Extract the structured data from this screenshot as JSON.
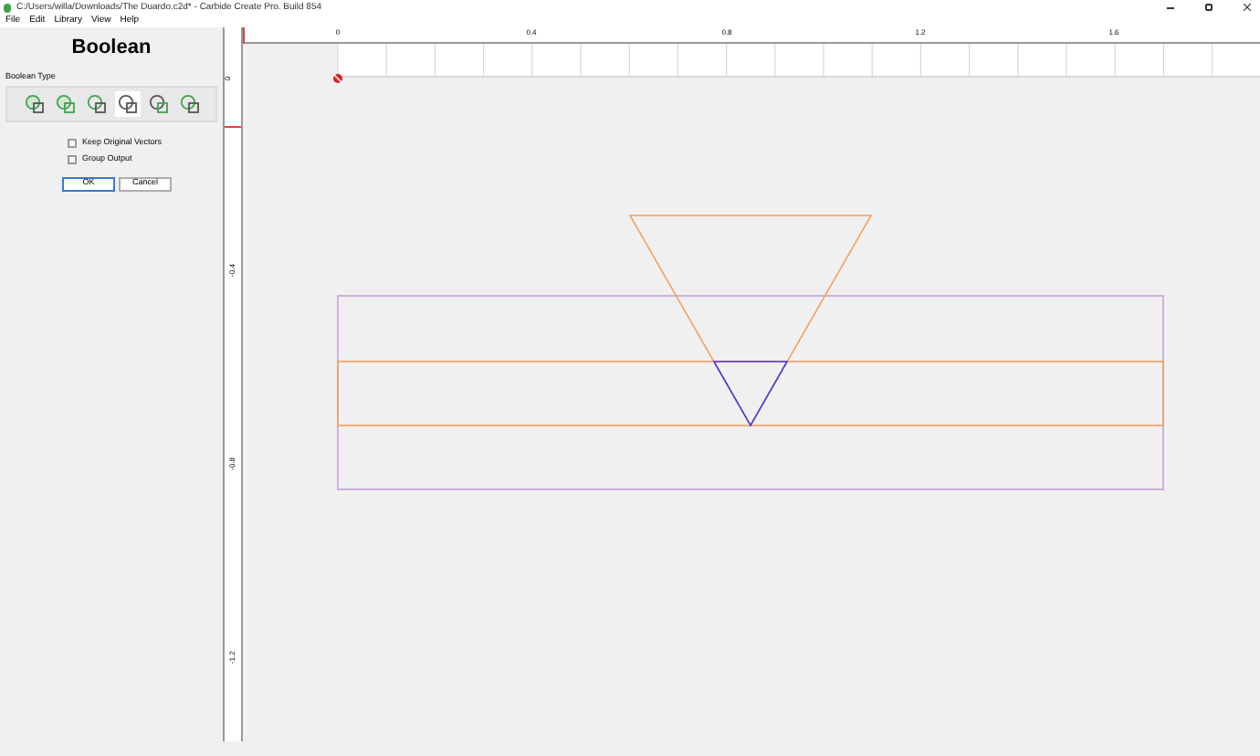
{
  "window": {
    "title": "C:/Users/willa/Downloads/The Duardo.c2d* - Carbide Create Pro. Build 854"
  },
  "menu": [
    "File",
    "Edit",
    "Library",
    "View",
    "Help"
  ],
  "panel": {
    "title": "Boolean",
    "type_label": "Boolean Type",
    "operations": [
      {
        "selected": false
      },
      {
        "selected": false
      },
      {
        "selected": false
      },
      {
        "selected": true
      },
      {
        "selected": false
      },
      {
        "selected": false
      }
    ],
    "options": [
      {
        "label": "Keep Original Vectors",
        "checked": false
      },
      {
        "label": "Group Output",
        "checked": false
      }
    ],
    "buttons": [
      {
        "label": "OK",
        "default": true
      },
      {
        "label": "Cancel",
        "default": false
      }
    ]
  },
  "top_ruler": [
    "0",
    "0.4",
    "0.8",
    "1.2",
    "1.6"
  ],
  "left_ruler": [
    "0",
    "-0.4",
    "-0.8",
    "-1.2"
  ]
}
